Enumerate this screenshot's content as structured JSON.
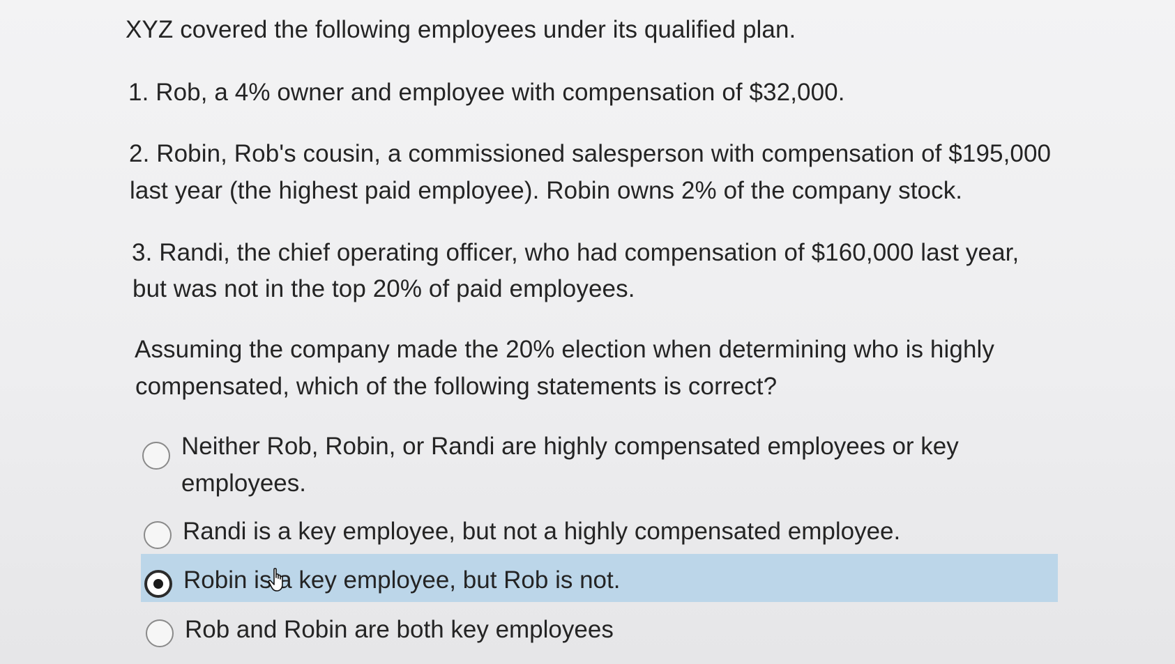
{
  "question": {
    "intro": "XYZ covered the following employees under its qualified plan.",
    "item1": "1. Rob, a 4% owner and employee with compensation of $32,000.",
    "item2_line1": "2. Robin, Rob's cousin, a commissioned salesperson with compensation of $195,000",
    "item2_line2": "last year (the highest paid employee). Robin owns 2% of the company stock.",
    "item3_line1": "3. Randi, the chief operating officer, who had compensation of $160,000 last year,",
    "item3_line2": "but was not in the top 20% of paid employees.",
    "prompt_line1": "Assuming the company made the 20% election when determining who is highly",
    "prompt_line2": "compensated, which of the following statements is correct?"
  },
  "options": [
    {
      "line1": "Neither Rob, Robin, or Randi are highly compensated employees or key",
      "line2": "employees.",
      "selected": false
    },
    {
      "line1": "Randi is a key employee, but not a highly compensated employee.",
      "selected": false
    },
    {
      "line1": "Robin is a key employee, but Rob is not.",
      "selected": true
    },
    {
      "line1": "Rob and Robin are both key employees",
      "selected": false
    }
  ],
  "colors": {
    "selected_highlight": "#bcd6e9",
    "text": "#242424"
  },
  "icons": {
    "cursor": "hand-pointer-icon"
  }
}
